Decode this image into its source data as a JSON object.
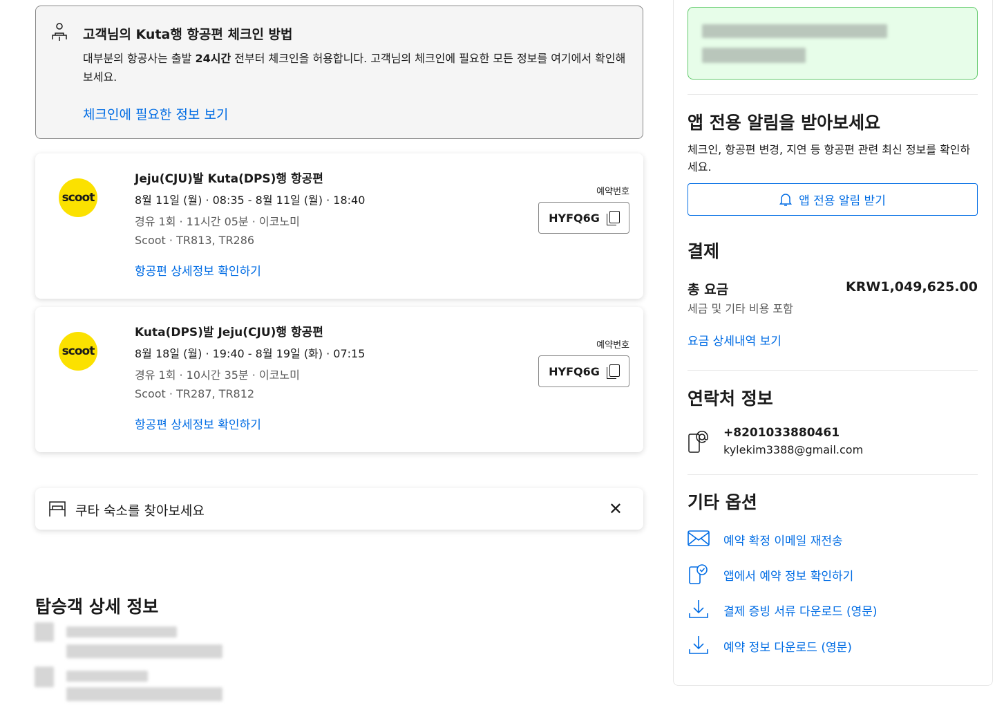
{
  "checkin": {
    "title": "고객님의 Kuta행 항공편 체크인 방법",
    "desc_prefix": "대부분의 항공사는 출발 ",
    "desc_bold": "24시간",
    "desc_suffix": " 전부터 체크인을 허용합니다. 고객님의 체크인에 필요한 모든 정보를 여기에서 확인해 보세요.",
    "link": "체크인에 필요한 정보 보기"
  },
  "flights": [
    {
      "logo": "scoot",
      "route": "Jeju(CJU)발 Kuta(DPS)행 항공편",
      "times": "8월 11일 (월) · 08:35 - 8월 11일 (월) · 18:40",
      "stops": "경유 1회 · 11시간 05분 · 이코노미",
      "carrier": "Scoot · TR813, TR286",
      "detail_link": "항공편 상세정보 확인하기",
      "reservation_label": "예약번호",
      "reservation_code": "HYFQ6G"
    },
    {
      "logo": "scoot",
      "route": "Kuta(DPS)발 Jeju(CJU)행 항공편",
      "times": "8월 18일 (월) · 19:40 - 8월 19일 (화) · 07:15",
      "stops": "경유 1회 · 10시간 35분 · 이코노미",
      "carrier": "Scoot · TR287, TR812",
      "detail_link": "항공편 상세정보 확인하기",
      "reservation_label": "예약번호",
      "reservation_code": "HYFQ6G"
    }
  ],
  "stay_banner": {
    "text": "쿠타 숙소를 찾아보세요"
  },
  "passengers": {
    "title": "탑승객 상세 정보"
  },
  "app_alert": {
    "title": "앱 전용 알림을 받아보세요",
    "desc": "체크인, 항공편 변경, 지연 등 항공편 관련 최신 정보를 확인하세요.",
    "button": "앱 전용 알림 받기"
  },
  "payment": {
    "title": "결제",
    "total_label": "총 요금",
    "total_value": "KRW1,049,625.00",
    "total_sub": "세금 및 기타 비용 포함",
    "detail_link": "요금 상세내역 보기"
  },
  "contact": {
    "title": "연락처 정보",
    "phone": "+8201033880461",
    "email": "kylekim3388@gmail.com"
  },
  "options": {
    "title": "기타 옵션",
    "items": [
      {
        "label": "예약 확정 이메일 재전송",
        "icon": "mail-icon"
      },
      {
        "label": "앱에서 예약 정보 확인하기",
        "icon": "phone-check-icon"
      },
      {
        "label": "결제 증빙 서류 다운로드 (영문)",
        "icon": "download-icon"
      },
      {
        "label": "예약 정보 다운로드 (영문)",
        "icon": "download-icon"
      }
    ]
  },
  "colors": {
    "link": "#006ce4",
    "scoot_yellow": "#fbe100",
    "success_bg": "#e7fde9",
    "success_border": "#5fc969"
  }
}
